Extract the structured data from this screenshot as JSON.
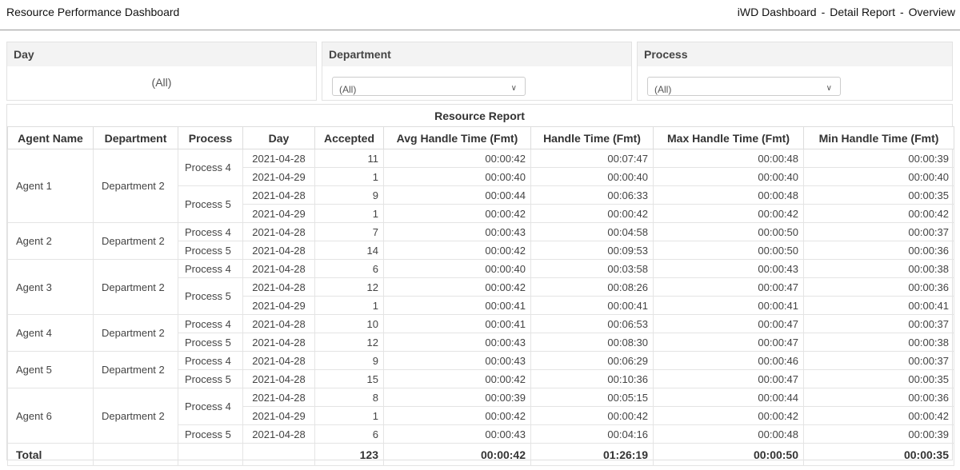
{
  "app": {
    "title": "Resource Performance Dashboard",
    "nav": [
      "iWD Dashboard",
      "Detail Report",
      "Overview"
    ],
    "nav_sep": "-"
  },
  "filters": {
    "day": {
      "label": "Day",
      "value": "(All)"
    },
    "department": {
      "label": "Department",
      "value": "(All)"
    },
    "process": {
      "label": "Process",
      "value": "(All)"
    }
  },
  "report": {
    "title": "Resource Report",
    "columns": [
      "Agent Name",
      "Department",
      "Process",
      "Day",
      "Accepted",
      "Avg Handle Time (Fmt)",
      "Handle Time (Fmt)",
      "Max Handle Time (Fmt)",
      "Min Handle Time (Fmt)"
    ],
    "agents": [
      {
        "name": "Agent 1",
        "department": "Department 2",
        "processes": [
          {
            "name": "Process 4",
            "rows": [
              {
                "day": "2021-04-28",
                "accepted": "11",
                "avg": "00:00:42",
                "handle": "00:07:47",
                "max": "00:00:48",
                "min": "00:00:39"
              },
              {
                "day": "2021-04-29",
                "accepted": "1",
                "avg": "00:00:40",
                "handle": "00:00:40",
                "max": "00:00:40",
                "min": "00:00:40"
              }
            ]
          },
          {
            "name": "Process 5",
            "rows": [
              {
                "day": "2021-04-28",
                "accepted": "9",
                "avg": "00:00:44",
                "handle": "00:06:33",
                "max": "00:00:48",
                "min": "00:00:35"
              },
              {
                "day": "2021-04-29",
                "accepted": "1",
                "avg": "00:00:42",
                "handle": "00:00:42",
                "max": "00:00:42",
                "min": "00:00:42"
              }
            ]
          }
        ]
      },
      {
        "name": "Agent 2",
        "department": "Department 2",
        "processes": [
          {
            "name": "Process 4",
            "rows": [
              {
                "day": "2021-04-28",
                "accepted": "7",
                "avg": "00:00:43",
                "handle": "00:04:58",
                "max": "00:00:50",
                "min": "00:00:37"
              }
            ]
          },
          {
            "name": "Process 5",
            "rows": [
              {
                "day": "2021-04-28",
                "accepted": "14",
                "avg": "00:00:42",
                "handle": "00:09:53",
                "max": "00:00:50",
                "min": "00:00:36"
              }
            ]
          }
        ]
      },
      {
        "name": "Agent 3",
        "department": "Department 2",
        "processes": [
          {
            "name": "Process 4",
            "rows": [
              {
                "day": "2021-04-28",
                "accepted": "6",
                "avg": "00:00:40",
                "handle": "00:03:58",
                "max": "00:00:43",
                "min": "00:00:38"
              }
            ]
          },
          {
            "name": "Process 5",
            "rows": [
              {
                "day": "2021-04-28",
                "accepted": "12",
                "avg": "00:00:42",
                "handle": "00:08:26",
                "max": "00:00:47",
                "min": "00:00:36"
              },
              {
                "day": "2021-04-29",
                "accepted": "1",
                "avg": "00:00:41",
                "handle": "00:00:41",
                "max": "00:00:41",
                "min": "00:00:41"
              }
            ]
          }
        ]
      },
      {
        "name": "Agent 4",
        "department": "Department 2",
        "processes": [
          {
            "name": "Process 4",
            "rows": [
              {
                "day": "2021-04-28",
                "accepted": "10",
                "avg": "00:00:41",
                "handle": "00:06:53",
                "max": "00:00:47",
                "min": "00:00:37"
              }
            ]
          },
          {
            "name": "Process 5",
            "rows": [
              {
                "day": "2021-04-28",
                "accepted": "12",
                "avg": "00:00:43",
                "handle": "00:08:30",
                "max": "00:00:47",
                "min": "00:00:38"
              }
            ]
          }
        ]
      },
      {
        "name": "Agent 5",
        "department": "Department 2",
        "processes": [
          {
            "name": "Process 4",
            "rows": [
              {
                "day": "2021-04-28",
                "accepted": "9",
                "avg": "00:00:43",
                "handle": "00:06:29",
                "max": "00:00:46",
                "min": "00:00:37"
              }
            ]
          },
          {
            "name": "Process 5",
            "rows": [
              {
                "day": "2021-04-28",
                "accepted": "15",
                "avg": "00:00:42",
                "handle": "00:10:36",
                "max": "00:00:47",
                "min": "00:00:35"
              }
            ]
          }
        ]
      },
      {
        "name": "Agent 6",
        "department": "Department 2",
        "processes": [
          {
            "name": "Process 4",
            "rows": [
              {
                "day": "2021-04-28",
                "accepted": "8",
                "avg": "00:00:39",
                "handle": "00:05:15",
                "max": "00:00:44",
                "min": "00:00:36"
              },
              {
                "day": "2021-04-29",
                "accepted": "1",
                "avg": "00:00:42",
                "handle": "00:00:42",
                "max": "00:00:42",
                "min": "00:00:42"
              }
            ]
          },
          {
            "name": "Process 5",
            "rows": [
              {
                "day": "2021-04-28",
                "accepted": "6",
                "avg": "00:00:43",
                "handle": "00:04:16",
                "max": "00:00:48",
                "min": "00:00:39"
              }
            ]
          }
        ]
      }
    ],
    "total": {
      "label": "Total",
      "accepted": "123",
      "avg": "00:00:42",
      "handle": "01:26:19",
      "max": "00:00:50",
      "min": "00:00:35"
    }
  }
}
